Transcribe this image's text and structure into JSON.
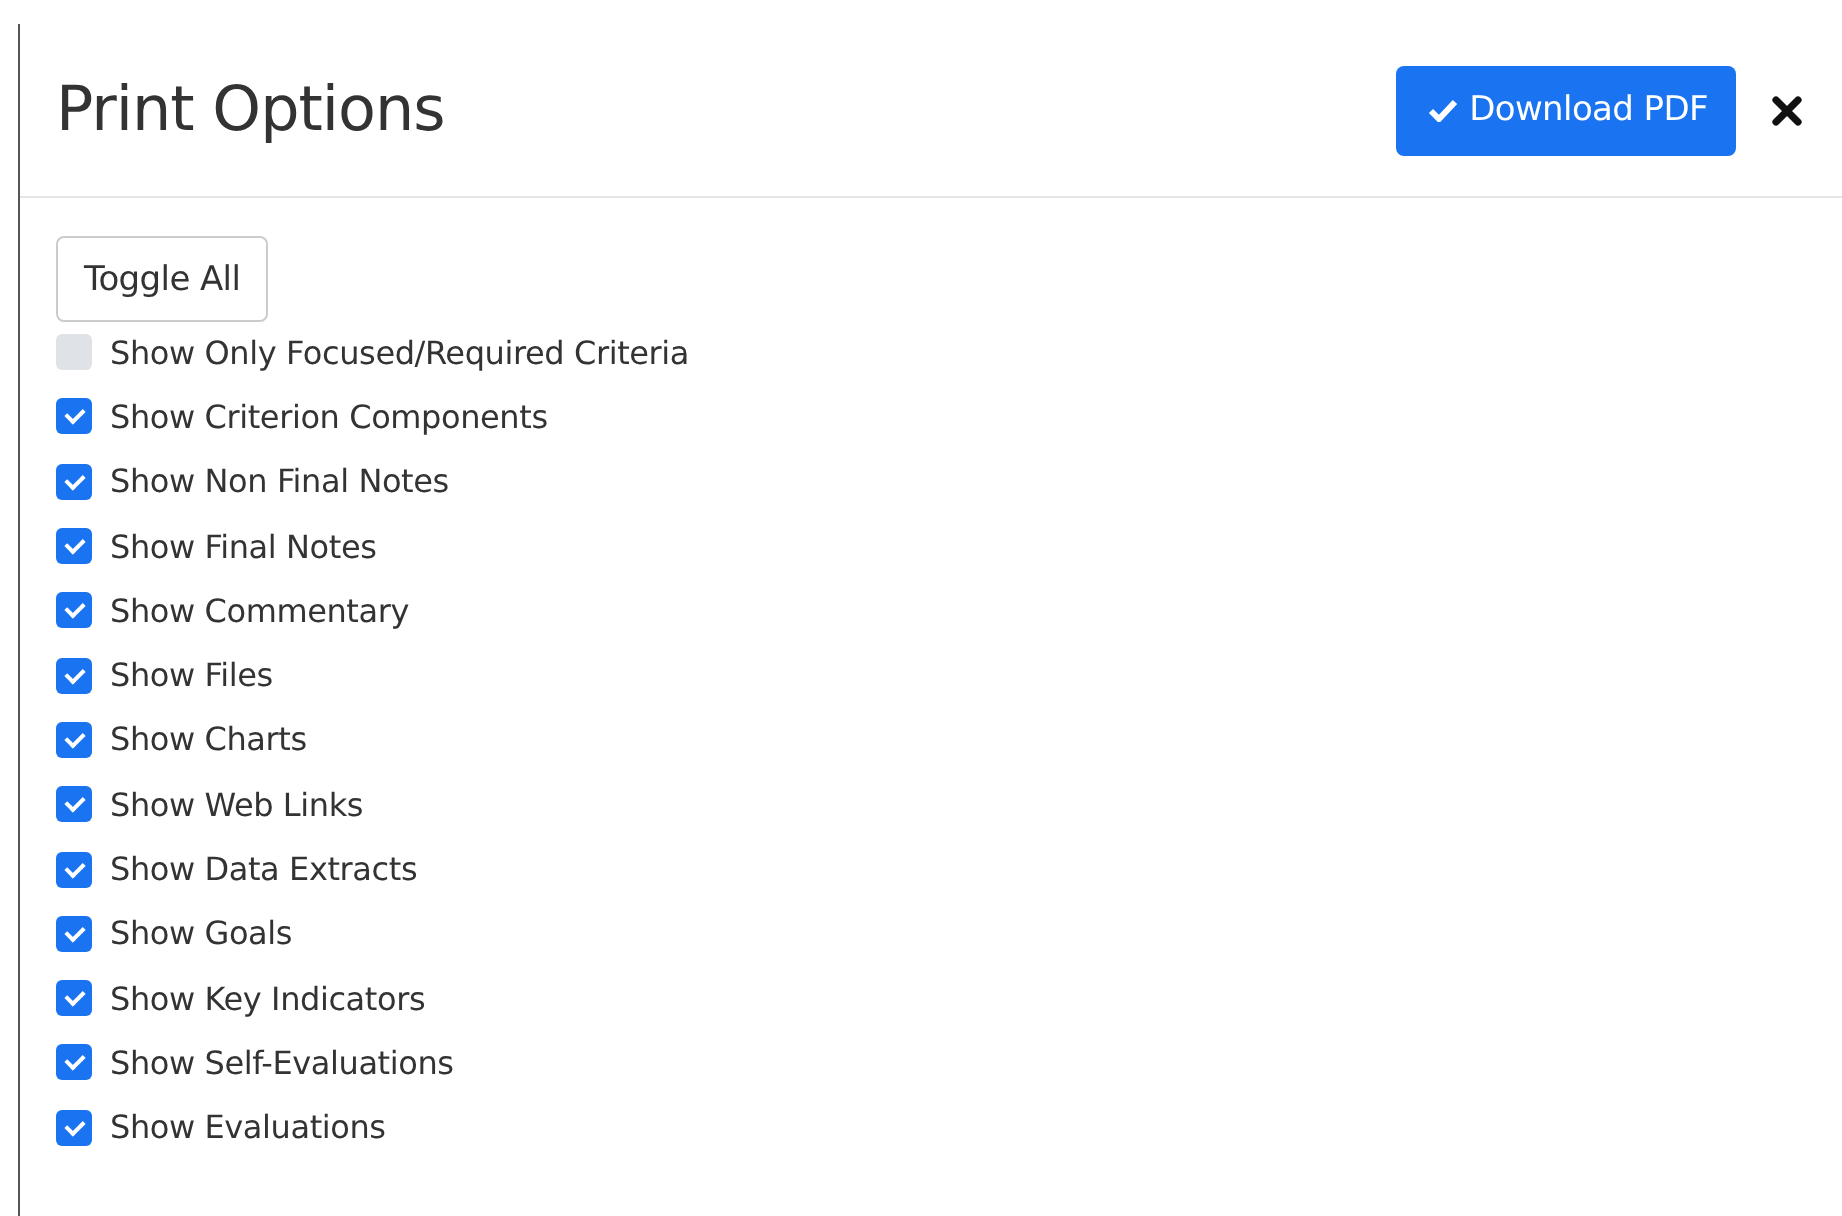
{
  "dialog": {
    "title": "Print Options",
    "download_button": "Download PDF"
  },
  "toggle_all_button": "Toggle All",
  "options": [
    {
      "label": "Show Only Focused/Required Criteria",
      "checked": false
    },
    {
      "label": "Show Criterion Components",
      "checked": true
    },
    {
      "label": "Show Non Final Notes",
      "checked": true
    },
    {
      "label": "Show Final Notes",
      "checked": true
    },
    {
      "label": "Show Commentary",
      "checked": true
    },
    {
      "label": "Show Files",
      "checked": true
    },
    {
      "label": "Show Charts",
      "checked": true
    },
    {
      "label": "Show Web Links",
      "checked": true
    },
    {
      "label": "Show Data Extracts",
      "checked": true
    },
    {
      "label": "Show Goals",
      "checked": true
    },
    {
      "label": "Show Key Indicators",
      "checked": true
    },
    {
      "label": "Show Self-Evaluations",
      "checked": true
    },
    {
      "label": "Show Evaluations",
      "checked": true
    }
  ]
}
